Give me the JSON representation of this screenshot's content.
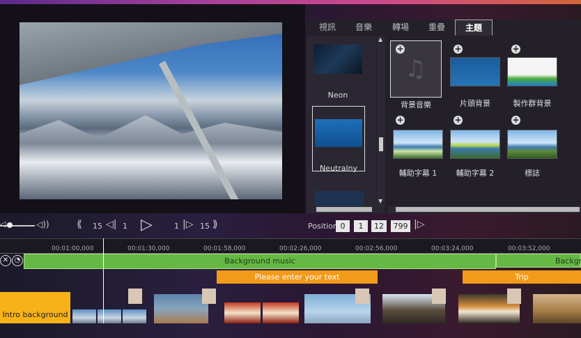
{
  "tabs": [
    {
      "label": "視訊"
    },
    {
      "label": "音樂"
    },
    {
      "label": "轉場"
    },
    {
      "label": "重疊"
    },
    {
      "label": "主題"
    }
  ],
  "themes": [
    {
      "label": "Neon"
    },
    {
      "label": "Neutralny"
    }
  ],
  "grid_items": [
    {
      "label": "背景音樂"
    },
    {
      "label": "片頭背景"
    },
    {
      "label": "製作群背景"
    },
    {
      "label": "輔助字幕 1"
    },
    {
      "label": "輔助字幕 2"
    },
    {
      "label": "標誌"
    }
  ],
  "transport": {
    "rewind_step": "15",
    "frame_back_step": "1",
    "frame_fwd_step": "1",
    "forward_step": "15",
    "position_label": "Position:",
    "position": {
      "h": "0",
      "m": "1",
      "s": "12",
      "ms": "799"
    }
  },
  "ruler": [
    "00:01:00,000",
    "00:01:30,000",
    "00:01:58,000",
    "00:02:26,000",
    "00:02:56,000",
    "00:03:24,000",
    "00:03:52,000"
  ],
  "tracks": {
    "music_label": "Background music",
    "music_label_2": "Backgro",
    "text_label": "Please enter your text",
    "trip_label": "Trip",
    "intro_label": "Intro background"
  },
  "colors": {
    "accent_orange": "#f39a1a",
    "music_green": "#66b845",
    "intro_yellow": "#f7b21a"
  }
}
